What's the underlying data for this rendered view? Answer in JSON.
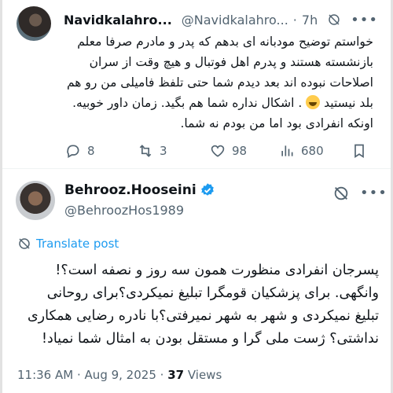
{
  "reply": {
    "display_name": "Navidkalahro...",
    "handle": "@Navidkalahro...",
    "separator": "·",
    "time": "7h",
    "text_lines": [
      "خواستم توضیح مودبانه ای بدهم که پدر و مادرم صرفا معلم",
      "بازنشسته هستند و پدرم اهل فوتبال و هیچ وقت از سران",
      "اصلاحات نبوده اند بعد دیدم شما حتی تلفظ فامیلی من رو هم",
      "بلد نیستید",
      ". اشکال نداره شما هم بگید. زمان داور خوبیه.",
      "اونکه انفرادی بود اما من بودم نه شما."
    ],
    "actions": {
      "replies": "8",
      "reposts": "3",
      "likes": "98",
      "views": "680"
    }
  },
  "main": {
    "display_name": "Behrooz.Hooseini",
    "handle": "@BehroozHos1989",
    "translate_label": "Translate post",
    "text_lines": [
      "پسرجان انفرادی منظورت همون سه روز و نصفه است؟!",
      "وانگهی. برای پزشکیان قومگرا تبلیغ نمیکردی؟برای روحانی",
      "تبلیغ نمیکردی و شهر به شهر نمیرفتی؟با نادره رضایی همکاری",
      "نداشتی؟ ژست ملی گرا و مستقل بودن به امثال شما نمیاد!"
    ],
    "time": "11:36 AM",
    "date": "Aug 9, 2025",
    "views": "37",
    "views_label": "Views",
    "sep": "·"
  },
  "colors": {
    "accent": "#1d9bf0",
    "muted": "#536471",
    "text": "#0f1419"
  },
  "icons": [
    "mute-icon",
    "more-icon",
    "reply-icon",
    "repost-icon",
    "like-icon",
    "views-icon",
    "bookmark-icon",
    "verified-icon",
    "translate-icon"
  ]
}
